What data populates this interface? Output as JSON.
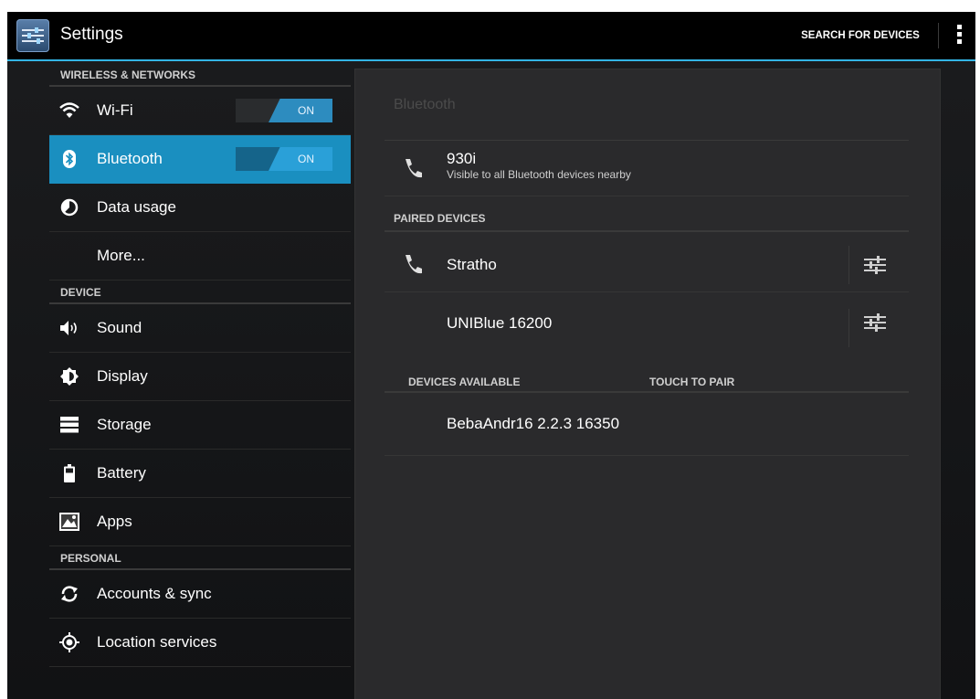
{
  "action_bar": {
    "title": "Settings",
    "search_button": "SEARCH FOR DEVICES",
    "app_icon": "settings-sliders-icon",
    "overflow_icon": "overflow-menu-icon"
  },
  "colors": {
    "accent": "#33b5e5",
    "selected": "#1a8fc0",
    "toggle_on": "#2d8cbf"
  },
  "sidebar": {
    "wireless_header": "WIRELESS & NETWORKS",
    "wifi": {
      "label": "Wi-Fi",
      "toggle": "ON",
      "icon": "wifi-icon"
    },
    "bluetooth": {
      "label": "Bluetooth",
      "toggle": "ON",
      "icon": "bluetooth-icon"
    },
    "data_usage": {
      "label": "Data usage",
      "icon": "data-usage-icon"
    },
    "more": {
      "label": "More..."
    },
    "device_header": "DEVICE",
    "sound": {
      "label": "Sound",
      "icon": "sound-icon"
    },
    "display": {
      "label": "Display",
      "icon": "display-icon"
    },
    "storage": {
      "label": "Storage",
      "icon": "storage-icon"
    },
    "battery": {
      "label": "Battery",
      "icon": "battery-icon"
    },
    "apps": {
      "label": "Apps",
      "icon": "apps-icon"
    },
    "personal_header": "PERSONAL",
    "accounts": {
      "label": "Accounts & sync",
      "icon": "sync-icon"
    },
    "location": {
      "label": "Location services",
      "icon": "location-icon"
    }
  },
  "bluetooth_pane": {
    "title": "Bluetooth",
    "this_device": {
      "name": "930i",
      "subtitle": "Visible to all Bluetooth devices nearby"
    },
    "paired_header": "PAIRED DEVICES",
    "paired": [
      {
        "name": "Stratho",
        "has_phone_icon": true
      },
      {
        "name": "UNIBlue 16200",
        "has_phone_icon": false
      }
    ],
    "available_header": "DEVICES AVAILABLE",
    "touch_to_pair": "TOUCH TO PAIR",
    "available": [
      {
        "name": "BebaAndr16 2.2.3 16350"
      }
    ]
  }
}
